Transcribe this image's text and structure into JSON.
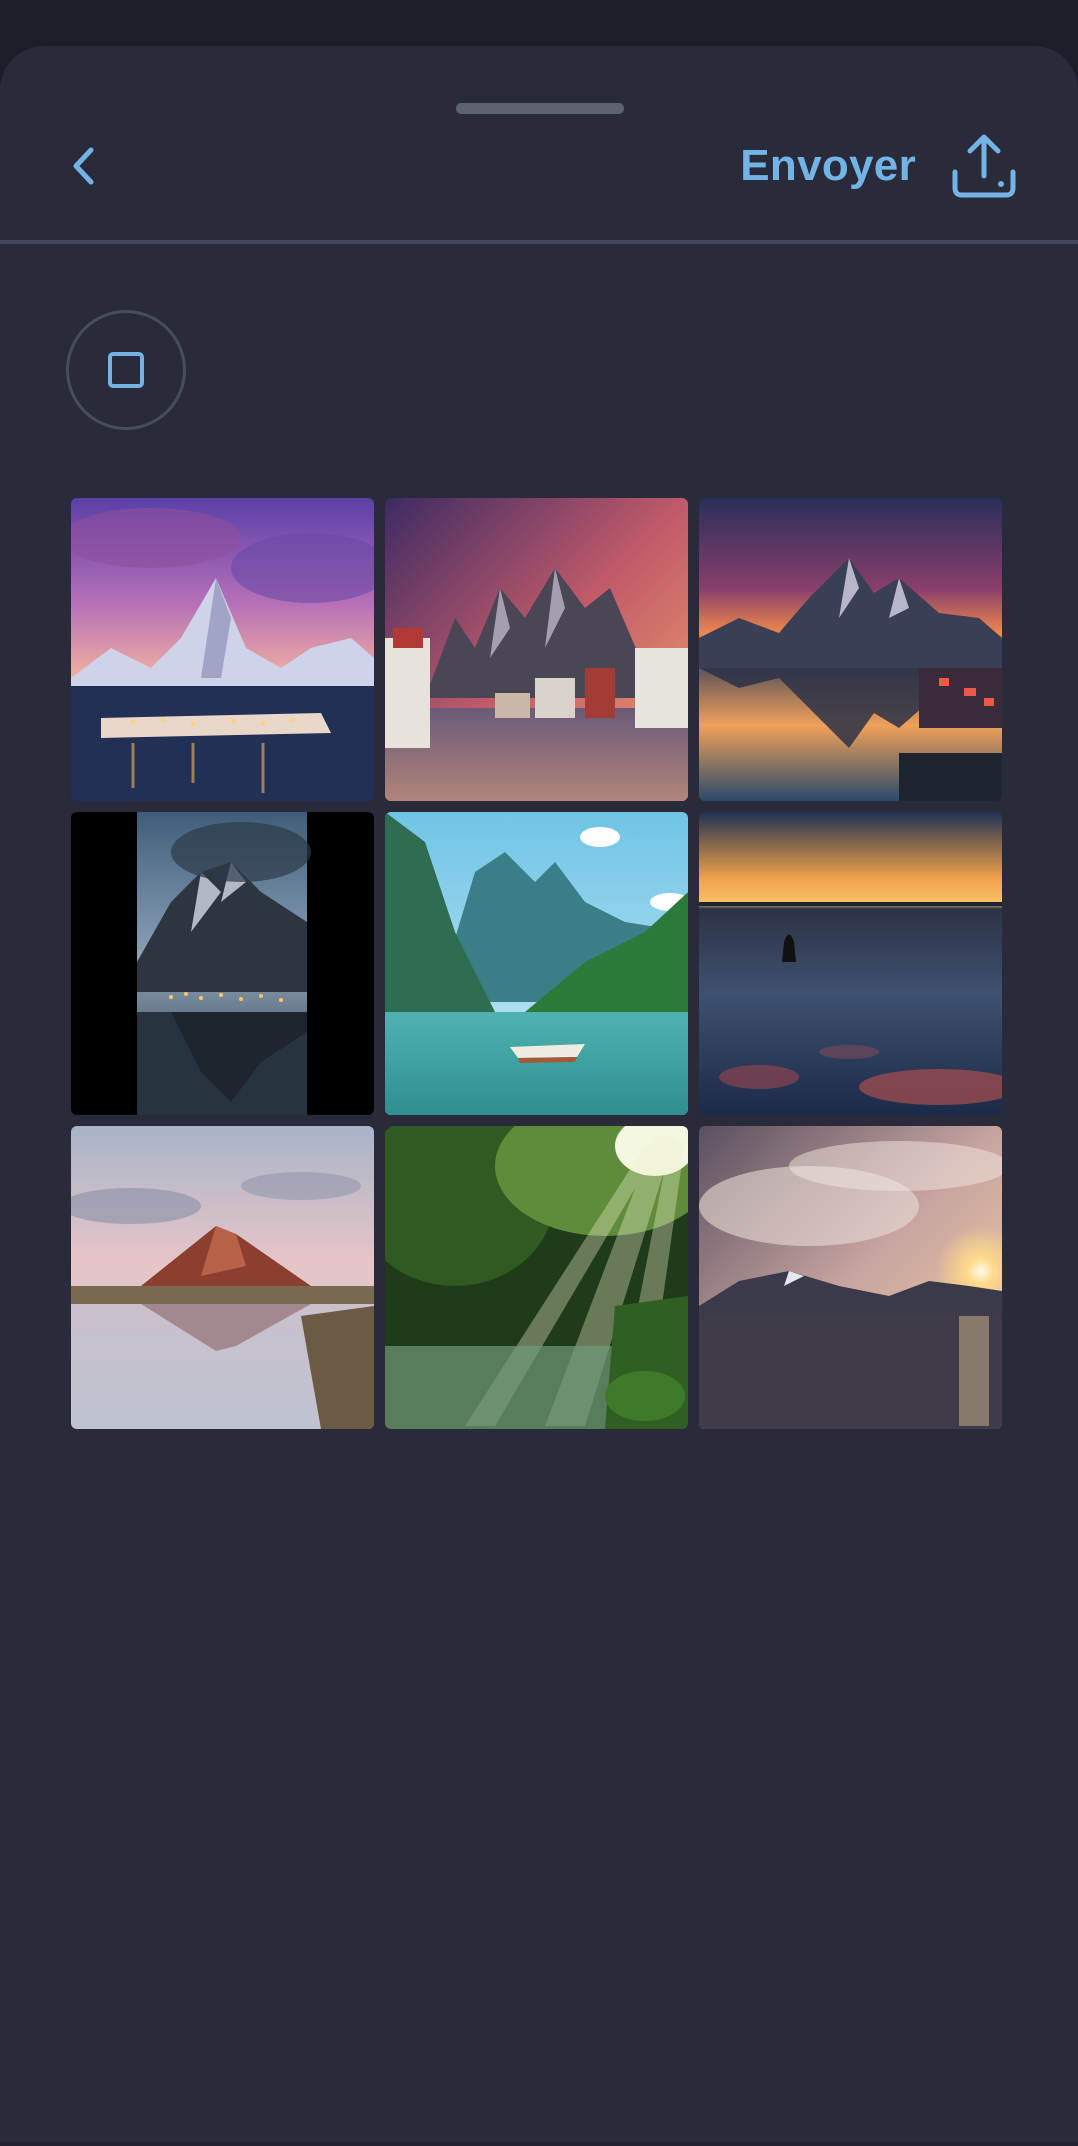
{
  "header": {
    "back_icon": "chevron-left-icon",
    "send_label": "Envoyer",
    "send_icon": "upload-icon",
    "accent_color": "#73b3e6"
  },
  "selection": {
    "select_all_icon": "square-checkbox-icon"
  },
  "photos": [
    {
      "scene": "snowy-peak-village-purple-sky"
    },
    {
      "scene": "harbor-town-mountains-sunset"
    },
    {
      "scene": "mountain-lake-reflection-sunset"
    },
    {
      "scene": "dark-peak-village-lights-portrait"
    },
    {
      "scene": "fjord-rowboat-turquoise"
    },
    {
      "scene": "calm-sea-boat-dusk"
    },
    {
      "scene": "volcano-reflection-lake"
    },
    {
      "scene": "forest-sunbeams-river"
    },
    {
      "scene": "lake-mountains-sunburst"
    }
  ],
  "colors": {
    "sheet_background": "#292b3b",
    "app_background": "#1c1d28"
  }
}
